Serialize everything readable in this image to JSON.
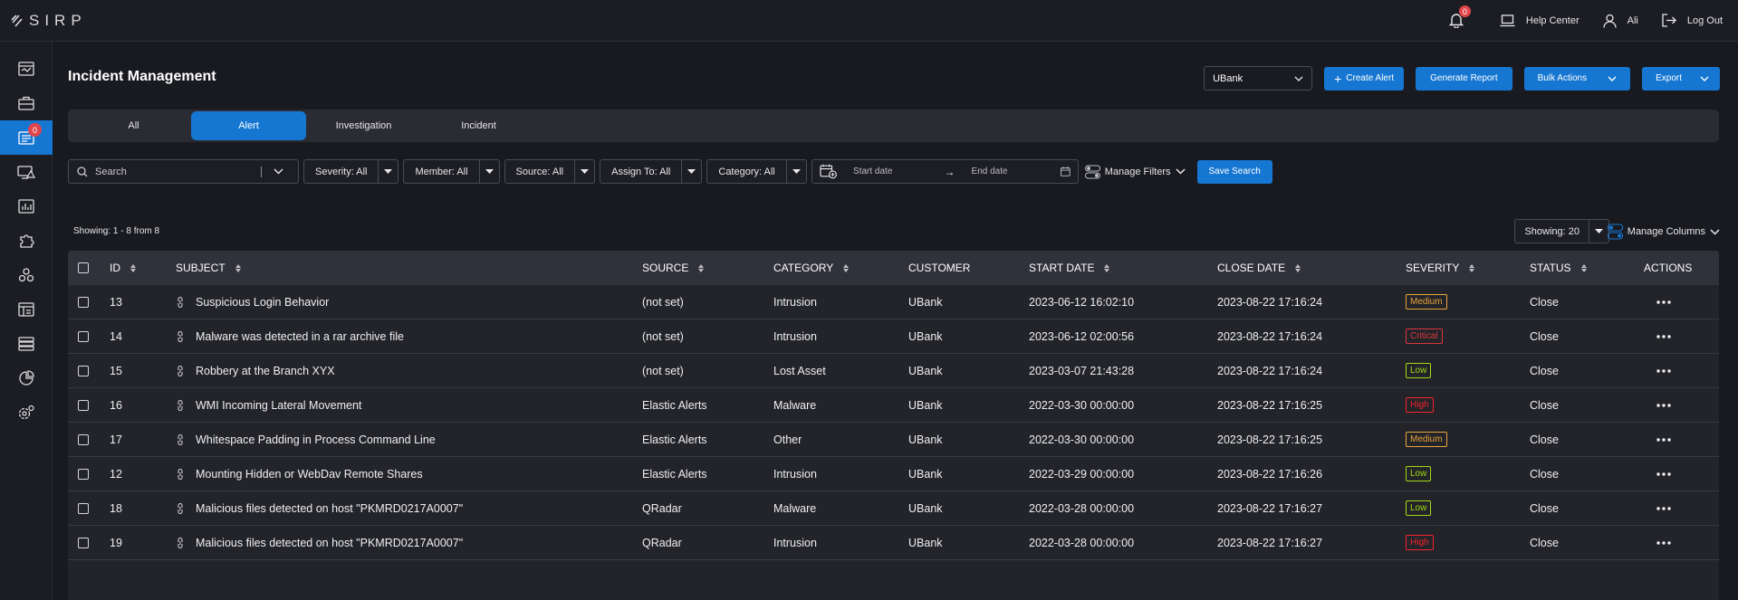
{
  "app": {
    "logo_text": "SIRP"
  },
  "topbar": {
    "notification_count": "0",
    "help_label": "Help Center",
    "user_label": "Ali",
    "logout_label": "Log Out"
  },
  "sidebar": {
    "items": [
      {
        "icon": "dashboard-icon"
      },
      {
        "icon": "briefcase-icon"
      },
      {
        "icon": "alerts-icon",
        "badge": "0",
        "active": true
      },
      {
        "icon": "monitor-alert-icon"
      },
      {
        "icon": "analytics-icon"
      },
      {
        "icon": "puzzle-icon"
      },
      {
        "icon": "integrations-icon"
      },
      {
        "icon": "reports-icon"
      },
      {
        "icon": "database-icon"
      },
      {
        "icon": "pie-chart-icon"
      },
      {
        "icon": "settings-icon"
      }
    ]
  },
  "page": {
    "title": "Incident Management",
    "org_select": "UBank",
    "create_alert": "Create Alert",
    "generate_report": "Generate Report",
    "bulk_actions": "Bulk Actions",
    "export": "Export"
  },
  "tabs": [
    {
      "label": "All"
    },
    {
      "label": "Alert",
      "active": true
    },
    {
      "label": "Investigation"
    },
    {
      "label": "Incident"
    }
  ],
  "filters": {
    "search_placeholder": "Search",
    "severity": "Severity: All",
    "member": "Member: All",
    "source": "Source: All",
    "assign_to": "Assign To: All",
    "category": "Category: All",
    "start_date_placeholder": "Start date",
    "end_date_placeholder": "End date",
    "manage_filters": "Manage Filters",
    "save_search": "Save Search"
  },
  "list": {
    "showing_count": "Showing: 1 - 8 from 8",
    "page_size": "Showing: 20",
    "manage_columns": "Manage Columns"
  },
  "table": {
    "headers": {
      "id": "ID",
      "subject": "SUBJECT",
      "source": "SOURCE",
      "category": "CATEGORY",
      "customer": "CUSTOMER",
      "start_date": "START DATE",
      "close_date": "CLOSE DATE",
      "severity": "SEVERITY",
      "status": "STATUS",
      "actions": "ACTIONS"
    },
    "rows": [
      {
        "id": "13",
        "subject": "Suspicious Login Behavior",
        "source": "(not set)",
        "category": "Intrusion",
        "customer": "UBank",
        "start": "2023-06-12 16:02:10",
        "close": "2023-08-22 17:16:24",
        "severity": "Medium",
        "status": "Close"
      },
      {
        "id": "14",
        "subject": "Malware was detected in a rar archive file",
        "source": "(not set)",
        "category": "Intrusion",
        "customer": "UBank",
        "start": "2023-06-12 02:00:56",
        "close": "2023-08-22 17:16:24",
        "severity": "Critical",
        "status": "Close"
      },
      {
        "id": "15",
        "subject": "Robbery at the Branch XYX",
        "source": "(not set)",
        "category": "Lost Asset",
        "customer": "UBank",
        "start": "2023-03-07 21:43:28",
        "close": "2023-08-22 17:16:24",
        "severity": "Low",
        "status": "Close"
      },
      {
        "id": "16",
        "subject": "WMI Incoming Lateral Movement",
        "source": "Elastic Alerts",
        "category": "Malware",
        "customer": "UBank",
        "start": "2022-03-30 00:00:00",
        "close": "2023-08-22 17:16:25",
        "severity": "High",
        "status": "Close"
      },
      {
        "id": "17",
        "subject": "Whitespace Padding in Process Command Line",
        "source": "Elastic Alerts",
        "category": "Other",
        "customer": "UBank",
        "start": "2022-03-30 00:00:00",
        "close": "2023-08-22 17:16:25",
        "severity": "Medium",
        "status": "Close"
      },
      {
        "id": "12",
        "subject": "Mounting Hidden or WebDav Remote Shares",
        "source": "Elastic Alerts",
        "category": "Intrusion",
        "customer": "UBank",
        "start": "2022-03-29 00:00:00",
        "close": "2023-08-22 17:16:26",
        "severity": "Low",
        "status": "Close"
      },
      {
        "id": "18",
        "subject": "Malicious files detected on host \"PKMRD0217A0007\"",
        "source": "QRadar",
        "category": "Malware",
        "customer": "UBank",
        "start": "2022-03-28 00:00:00",
        "close": "2023-08-22 17:16:27",
        "severity": "Low",
        "status": "Close"
      },
      {
        "id": "19",
        "subject": "Malicious files detected on host \"PKMRD0217A0007\"",
        "source": "QRadar",
        "category": "Intrusion",
        "customer": "UBank",
        "start": "2022-03-28 00:00:00",
        "close": "2023-08-22 17:16:27",
        "severity": "High",
        "status": "Close"
      }
    ]
  },
  "severity_colors": {
    "Medium": "#e9a23b",
    "Critical": "#d9363e",
    "Low": "#a0d911",
    "High": "#f5222d"
  },
  "colors": {
    "accent": "#1677d2",
    "background": "#191a1f"
  }
}
